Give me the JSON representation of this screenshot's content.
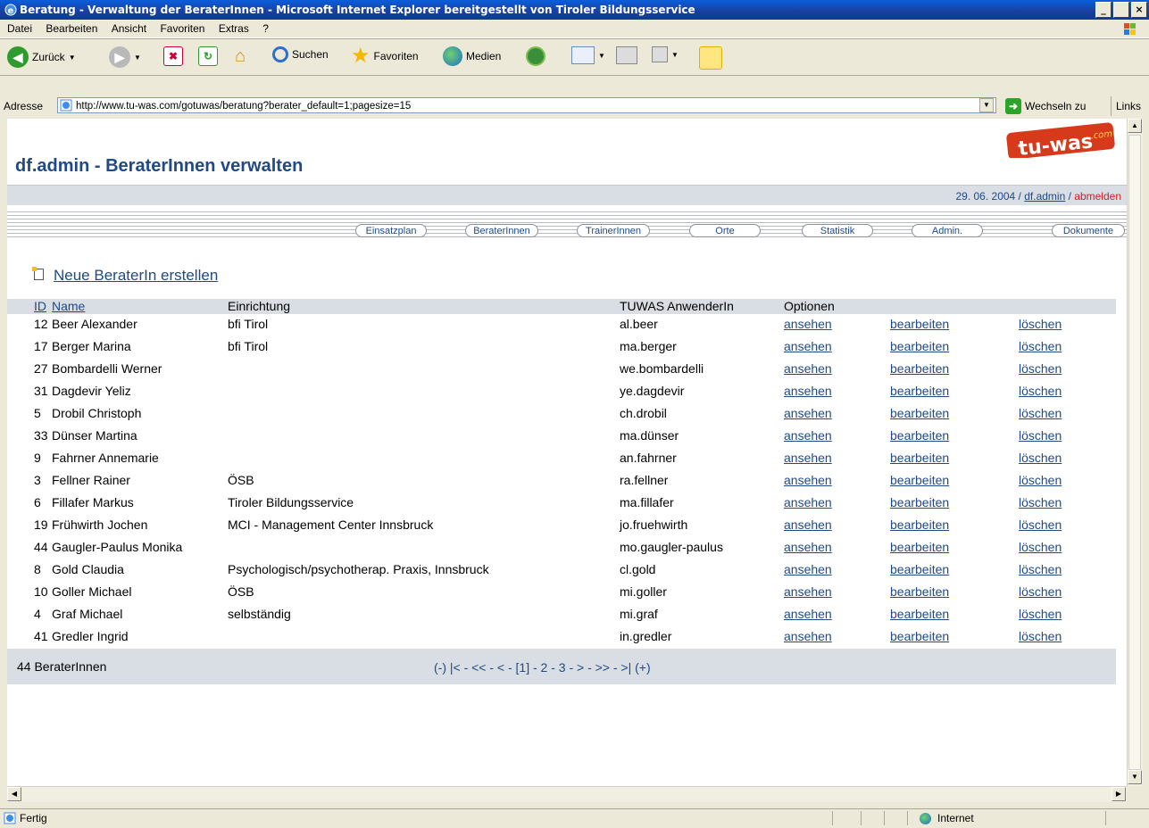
{
  "window": {
    "title": "Beratung - Verwaltung der BeraterInnen - Microsoft Internet Explorer bereitgestellt von Tiroler Bildungsservice",
    "minimize": "_",
    "maximize": " ",
    "close": "×"
  },
  "menu": [
    "Datei",
    "Bearbeiten",
    "Ansicht",
    "Favoriten",
    "Extras",
    "?"
  ],
  "toolbar": {
    "back": "Zurück",
    "search": "Suchen",
    "favorites": "Favoriten",
    "media": "Medien"
  },
  "address": {
    "label": "Adresse",
    "url": "http://www.tu-was.com/gotuwas/beratung?berater_default=1;pagesize=15",
    "go": "Wechseln zu",
    "links": "Links"
  },
  "page": {
    "title": "df.admin - BeraterInnen verwalten",
    "logo": "tu-was.com",
    "date": "29. 06. 2004",
    "user": "df.admin",
    "logout": "abmelden",
    "new_link": "Neue BeraterIn erstellen",
    "nav": [
      "Einsatzplan",
      "BeraterInnen",
      "TrainerInnen",
      "Orte",
      "Statistik",
      "Admin.",
      "Dokumente"
    ]
  },
  "table": {
    "headers": {
      "id": "ID",
      "name": "Name",
      "einrichtung": "Einrichtung",
      "user": "TUWAS AnwenderIn",
      "options": "Optionen"
    },
    "actions": {
      "view": "ansehen",
      "edit": "bearbeiten",
      "delete": "löschen"
    },
    "rows": [
      {
        "id": "12",
        "name": "Beer Alexander",
        "einrichtung": "bfi Tirol",
        "user": "al.beer"
      },
      {
        "id": "17",
        "name": "Berger Marina",
        "einrichtung": "bfi Tirol",
        "user": "ma.berger"
      },
      {
        "id": "27",
        "name": "Bombardelli Werner",
        "einrichtung": "",
        "user": "we.bombardelli"
      },
      {
        "id": "31",
        "name": "Dagdevir Yeliz",
        "einrichtung": "",
        "user": "ye.dagdevir"
      },
      {
        "id": "5",
        "name": "Drobil Christoph",
        "einrichtung": "",
        "user": "ch.drobil"
      },
      {
        "id": "33",
        "name": "Dünser Martina",
        "einrichtung": "",
        "user": "ma.dünser"
      },
      {
        "id": "9",
        "name": "Fahrner Annemarie",
        "einrichtung": "",
        "user": "an.fahrner"
      },
      {
        "id": "3",
        "name": "Fellner Rainer",
        "einrichtung": "ÖSB",
        "user": "ra.fellner"
      },
      {
        "id": "6",
        "name": "Fillafer Markus",
        "einrichtung": "Tiroler Bildungsservice",
        "user": "ma.fillafer"
      },
      {
        "id": "19",
        "name": "Frühwirth Jochen",
        "einrichtung": "MCI - Management Center Innsbruck",
        "user": "jo.fruehwirth"
      },
      {
        "id": "44",
        "name": "Gaugler-Paulus Monika",
        "einrichtung": "",
        "user": "mo.gaugler-paulus"
      },
      {
        "id": "8",
        "name": "Gold Claudia",
        "einrichtung": "Psychologisch/psychotherap. Praxis, Innsbruck",
        "user": "cl.gold"
      },
      {
        "id": "10",
        "name": "Goller Michael",
        "einrichtung": "ÖSB",
        "user": "mi.goller"
      },
      {
        "id": "4",
        "name": "Graf Michael",
        "einrichtung": "selbständig",
        "user": "mi.graf"
      },
      {
        "id": "41",
        "name": "Gredler Ingrid",
        "einrichtung": "",
        "user": "in.gredler"
      }
    ],
    "count": "44 BeraterInnen",
    "pager": "(-) |< - << - < - [1] - 2 - 3 - > - >> - >| (+)"
  },
  "status": {
    "text": "Fertig",
    "zone": "Internet"
  }
}
